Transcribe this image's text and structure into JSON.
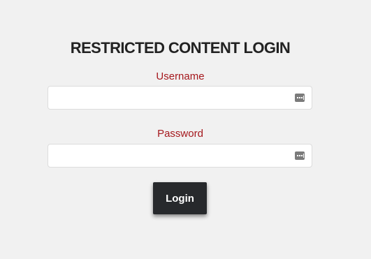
{
  "form": {
    "title": "RESTRICTED CONTENT LOGIN",
    "username": {
      "label": "Username",
      "value": "",
      "placeholder": "",
      "icon": "password-manager-icon"
    },
    "password": {
      "label": "Password",
      "value": "",
      "placeholder": "",
      "icon": "password-manager-icon"
    },
    "submit_label": "Login"
  },
  "colors": {
    "background": "#f1f1f1",
    "title": "#222222",
    "label": "#a5181d",
    "button": "#27292c",
    "button_text": "#ffffff"
  }
}
